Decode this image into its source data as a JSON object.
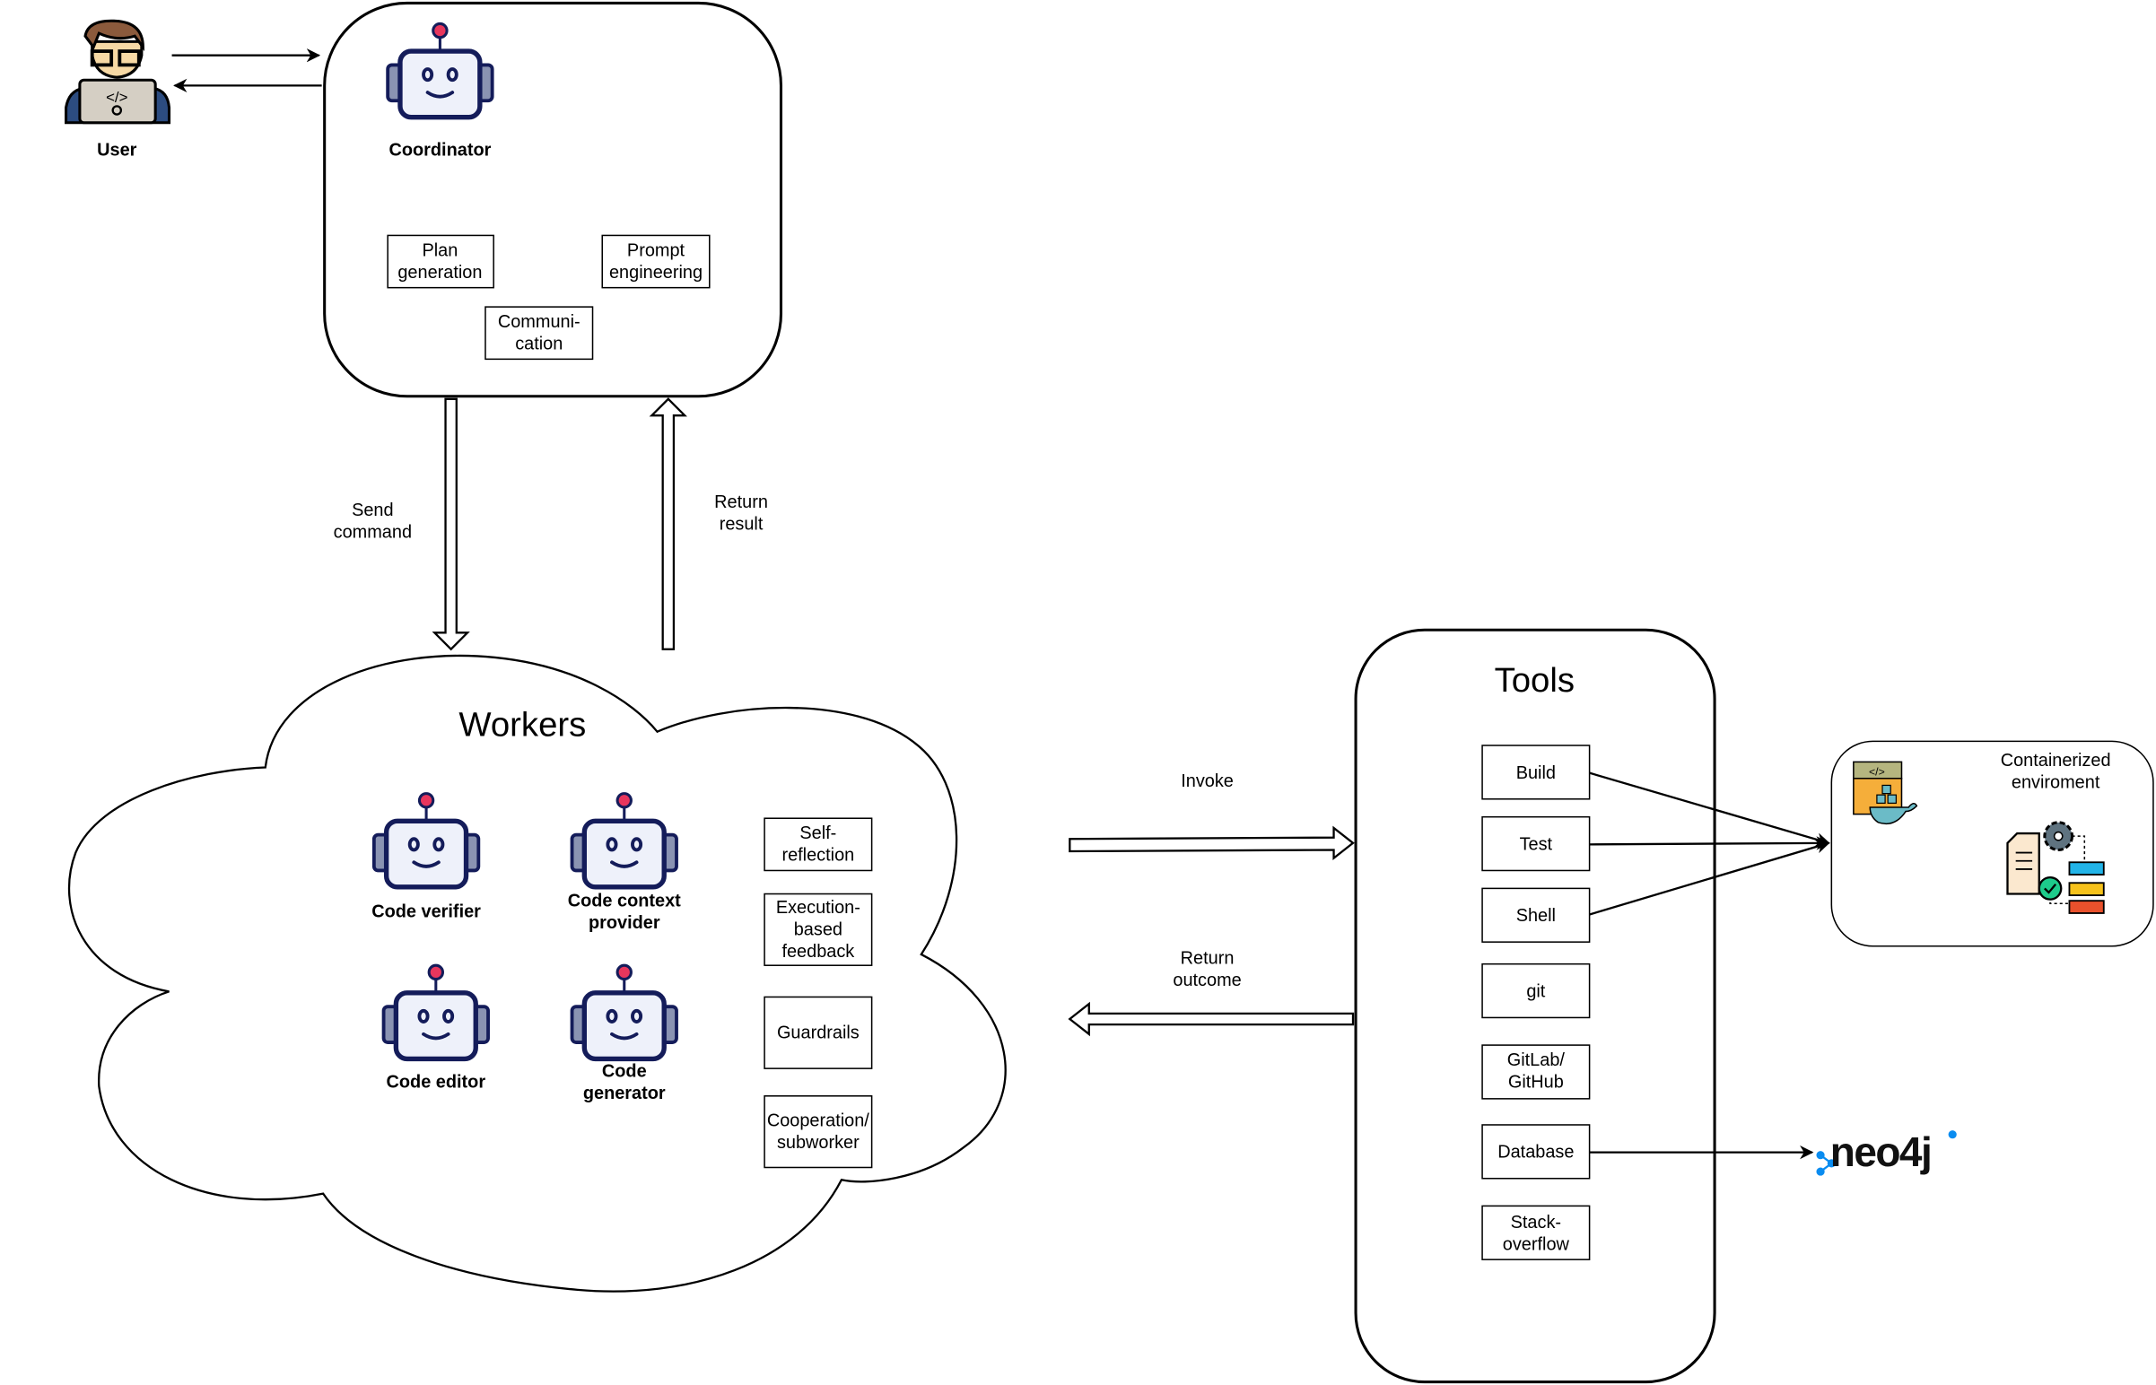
{
  "user": {
    "label": "User"
  },
  "coordinator": {
    "label": "Coordinator",
    "modules": [
      {
        "line1": "Plan",
        "line2": "generation"
      },
      {
        "line1": "Prompt",
        "line2": "engineering"
      },
      {
        "line1": "Communi-",
        "line2": "cation"
      }
    ]
  },
  "flows": {
    "send_command": {
      "line1": "Send",
      "line2": "command"
    },
    "return_result": {
      "line1": "Return",
      "line2": "result"
    },
    "invoke": "Invoke",
    "return_outcome": {
      "line1": "Return",
      "line2": "outcome"
    }
  },
  "workers": {
    "title": "Workers",
    "agents": [
      {
        "line1": "Code verifier",
        "line2": ""
      },
      {
        "line1": "Code context",
        "line2": "provider"
      },
      {
        "line1": "Code editor",
        "line2": ""
      },
      {
        "line1": "Code",
        "line2": "generator"
      }
    ],
    "capabilities": [
      {
        "line1": "Self-",
        "line2": "reflection",
        "line3": ""
      },
      {
        "line1": "Execution-",
        "line2": "based",
        "line3": "feedback"
      },
      {
        "line1": "Guardrails",
        "line2": "",
        "line3": ""
      },
      {
        "line1": "Cooperation/",
        "line2": "subworker",
        "line3": ""
      }
    ]
  },
  "tools": {
    "title": "Tools",
    "items": [
      {
        "line1": "Build",
        "line2": ""
      },
      {
        "line1": "Test",
        "line2": ""
      },
      {
        "line1": "Shell",
        "line2": ""
      },
      {
        "line1": "git",
        "line2": ""
      },
      {
        "line1": "GitLab/",
        "line2": "GitHub"
      },
      {
        "line1": "Database",
        "line2": ""
      },
      {
        "line1": "Stack-",
        "line2": "overflow"
      }
    ]
  },
  "container": {
    "line1": "Containerized",
    "line2": "enviroment"
  },
  "neo4j": {
    "logo_text": "neo4j",
    "color": "#0A8CF0"
  },
  "colors": {
    "robot_body": "#EEF1FA",
    "robot_outline": "#141C5A",
    "antenna": "#E8365D"
  }
}
